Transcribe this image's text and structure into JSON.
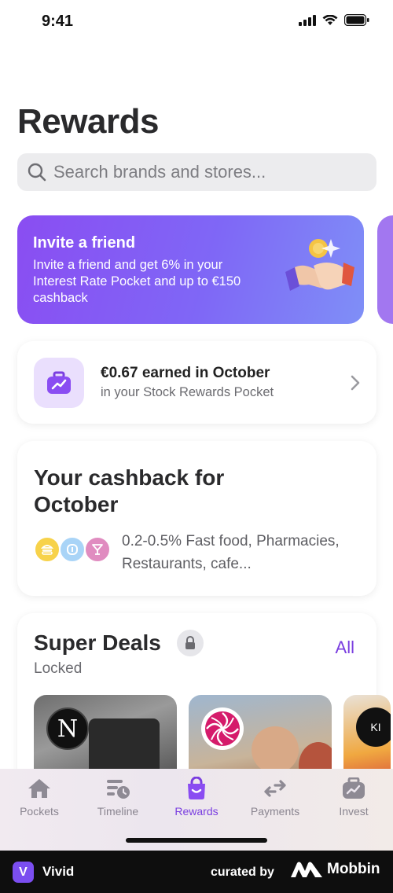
{
  "status_bar": {
    "time": "9:41"
  },
  "page": {
    "title": "Rewards"
  },
  "search": {
    "placeholder": "Search brands and stores..."
  },
  "invite": {
    "title": "Invite a friend",
    "body": "Invite a friend and get 6% in your Interest Rate Pocket and up to €150 cashback",
    "icon": "handshake-icon"
  },
  "stock_rewards": {
    "title": "€0.67 earned in October",
    "subtitle": "in your Stock Rewards Pocket",
    "icon": "briefcase-chart-icon"
  },
  "cashback": {
    "title": "Your cashback for October",
    "description": "0.2-0.5% Fast food, Pharmacies, Restaurants, cafe...",
    "category_icons": [
      "burger-icon",
      "pharmacy-icon",
      "cocktail-icon"
    ],
    "category_colors": [
      "#f7d24a",
      "#a9d4f7",
      "#e08cc0"
    ]
  },
  "super_deals": {
    "title": "Super Deals",
    "subtitle": "Locked",
    "all_label": "All",
    "deals": [
      {
        "brand": "N",
        "logo_color": "#111111"
      },
      {
        "brand": "",
        "logo_color": "#ffffff"
      },
      {
        "brand": "KI",
        "logo_color": "#111111"
      }
    ]
  },
  "tabs": [
    {
      "label": "Pockets",
      "icon": "home-icon",
      "active": false
    },
    {
      "label": "Timeline",
      "icon": "timeline-icon",
      "active": false
    },
    {
      "label": "Rewards",
      "icon": "shopping-bag-icon",
      "active": true
    },
    {
      "label": "Payments",
      "icon": "transfer-arrows-icon",
      "active": false
    },
    {
      "label": "Invest",
      "icon": "invest-briefcase-icon",
      "active": false
    }
  ],
  "footer": {
    "app_name": "Vivid",
    "app_initial": "V",
    "curated_by": "curated by",
    "brand": "Mobbin"
  },
  "colors": {
    "accent": "#7a3ee0",
    "invite_gradient_start": "#8a4df2",
    "invite_gradient_end": "#7f8ff7"
  }
}
